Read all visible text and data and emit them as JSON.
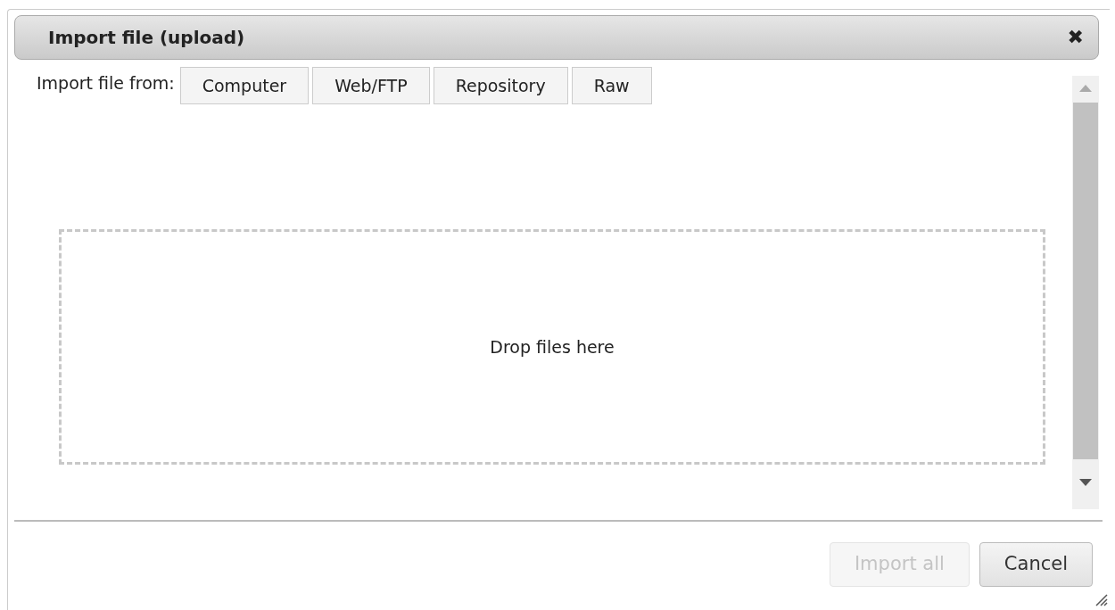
{
  "dialog": {
    "title": "Import file (upload)",
    "close": "✖"
  },
  "source": {
    "label": "Import file from:",
    "options": [
      {
        "label": "Computer",
        "selected": false
      },
      {
        "label": "Web/FTP",
        "selected": false
      },
      {
        "label": "Repository",
        "selected": false
      },
      {
        "label": "Raw",
        "selected": false
      }
    ]
  },
  "dropzone": {
    "text": "Drop files here"
  },
  "buttons": [
    {
      "label": "Import all",
      "disabled": true
    },
    {
      "label": "Cancel",
      "disabled": false
    }
  ]
}
